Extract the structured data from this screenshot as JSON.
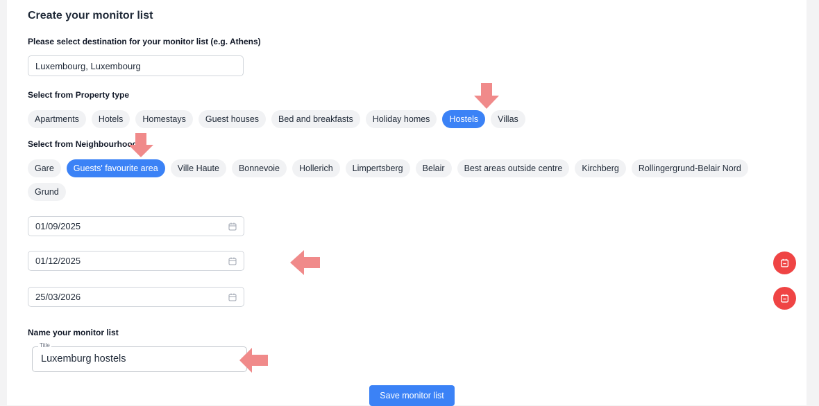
{
  "page": {
    "title": "Create your monitor list",
    "destination_label": "Please select destination for your monitor list (e.g. Athens)",
    "destination_value": "Luxembourg, Luxembourg",
    "property_label": "Select from Property type",
    "property_types": [
      {
        "label": "Apartments",
        "selected": false
      },
      {
        "label": "Hotels",
        "selected": false
      },
      {
        "label": "Homestays",
        "selected": false
      },
      {
        "label": "Guest houses",
        "selected": false
      },
      {
        "label": "Bed and breakfasts",
        "selected": false
      },
      {
        "label": "Holiday homes",
        "selected": false
      },
      {
        "label": "Hostels",
        "selected": true
      },
      {
        "label": "Villas",
        "selected": false
      }
    ],
    "neighbourhood_label": "Select from Neighbourhood",
    "neighbourhoods": [
      {
        "label": "Gare",
        "selected": false
      },
      {
        "label": "Guests' favourite area",
        "selected": true
      },
      {
        "label": "Ville Haute",
        "selected": false
      },
      {
        "label": "Bonnevoie",
        "selected": false
      },
      {
        "label": "Hollerich",
        "selected": false
      },
      {
        "label": "Limpertsberg",
        "selected": false
      },
      {
        "label": "Belair",
        "selected": false
      },
      {
        "label": "Best areas outside centre",
        "selected": false
      },
      {
        "label": "Kirchberg",
        "selected": false
      },
      {
        "label": "Rollingergrund-Belair Nord",
        "selected": false
      },
      {
        "label": "Grund",
        "selected": false
      }
    ],
    "dates": [
      "01/09/2025",
      "01/12/2025",
      "25/03/2026"
    ],
    "name_label": "Name your monitor list",
    "name_field_legend": "Title",
    "name_value": "Luxemburg hostels",
    "save_label": "Save monitor list"
  },
  "colors": {
    "accent": "#3b82f6",
    "danger": "#ef4444",
    "annotation_arrow": "#f08a8a",
    "chip_bg": "#f1f2f4"
  },
  "icons": {
    "date_field": "calendar-icon",
    "remove_date": "calendar-remove-icon",
    "annotation": "arrow-icon"
  }
}
